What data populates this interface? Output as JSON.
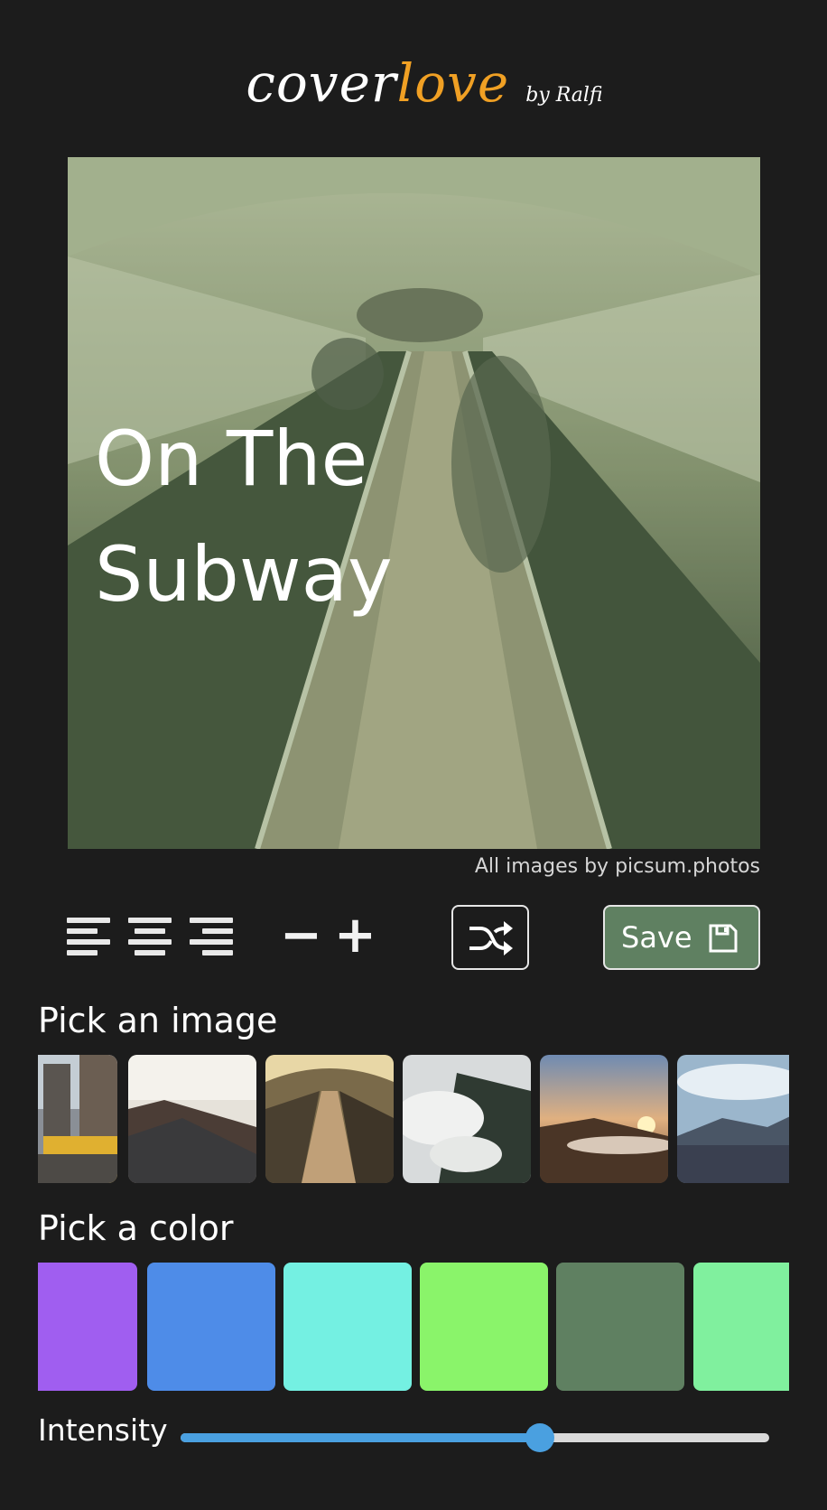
{
  "header": {
    "logo_part1": "cover",
    "logo_part2": "love",
    "logo_by": "by Ralfi",
    "logo_accent_color": "#f0a024"
  },
  "cover": {
    "title_line1": "On The",
    "title_line2": "Subway",
    "tint_color": "#5f8061",
    "credit": "All images by picsum.photos"
  },
  "toolbar": {
    "align_left_icon": "align-left-icon",
    "align_center_icon": "align-center-icon",
    "align_right_icon": "align-right-icon",
    "decrease_label": "−",
    "increase_label": "+",
    "shuffle_icon": "shuffle-icon",
    "save_label": "Save",
    "save_icon": "floppy-disk-icon",
    "save_color": "#5f8061"
  },
  "image_picker": {
    "heading": "Pick an image",
    "images": [
      "city-street-taxi",
      "mountain-rock-clouds",
      "subway-escalator",
      "forest-fog-mountain",
      "sunset-mountain-fog",
      "lake-mountain-clouds"
    ],
    "selected_index": 2
  },
  "color_picker": {
    "heading": "Pick a color",
    "colors": [
      "#a05ef0",
      "#4e8ce8",
      "#74f0e2",
      "#8af46a",
      "#5f8061",
      "#80f09e"
    ],
    "selected_index": 4
  },
  "intensity": {
    "label": "Intensity",
    "value": 0.61
  }
}
